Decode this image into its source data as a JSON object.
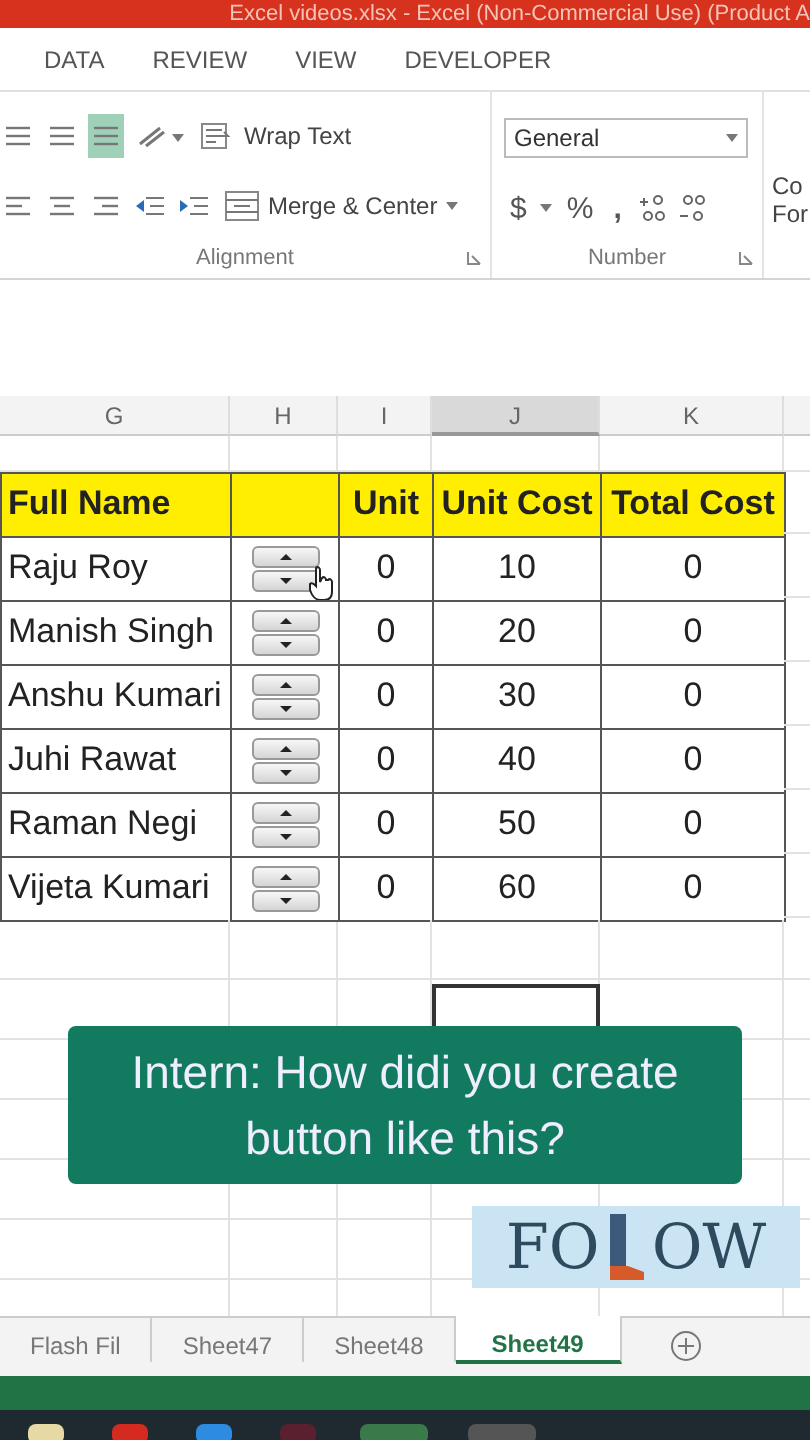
{
  "title_bar": {
    "title": "Excel videos.xlsx -  Excel (Non-Commercial Use) (Product A"
  },
  "ribbon_tabs": [
    {
      "label": "DATA",
      "selected": false
    },
    {
      "label": "REVIEW",
      "selected": false
    },
    {
      "label": "VIEW",
      "selected": false
    },
    {
      "label": "DEVELOPER",
      "selected": false
    }
  ],
  "alignment": {
    "vertical_align": [
      {
        "selected": false
      },
      {
        "selected": false
      },
      {
        "selected": true
      }
    ],
    "wrap_text": "Wrap Text",
    "merge_center": "Merge & Center",
    "label": "Alignment"
  },
  "number": {
    "format": "General",
    "currency": "$",
    "percent": "%",
    "comma": ",",
    "label": "Number"
  },
  "styles": {
    "line_1": "Co",
    "line_2": "For"
  },
  "columns": [
    {
      "label": "G",
      "selected": false
    },
    {
      "label": "H",
      "selected": false
    },
    {
      "label": "I",
      "selected": false
    },
    {
      "label": "J",
      "selected": true
    },
    {
      "label": "K",
      "selected": false
    }
  ],
  "table": {
    "headers": [
      "Full Name",
      "Unit",
      "Unit Cost",
      "Total Cost"
    ],
    "rows": [
      {
        "name": "Raju Roy",
        "unit": "0",
        "unit_cost": "10",
        "total_cost": "0",
        "hovered": true
      },
      {
        "name": "Manish Singh",
        "unit": "0",
        "unit_cost": "20",
        "total_cost": "0",
        "hovered": false
      },
      {
        "name": "Anshu Kumari",
        "unit": "0",
        "unit_cost": "30",
        "total_cost": "0",
        "hovered": false
      },
      {
        "name": "Juhi Rawat",
        "unit": "0",
        "unit_cost": "40",
        "total_cost": "0",
        "hovered": false
      },
      {
        "name": "Raman Negi",
        "unit": "0",
        "unit_cost": "50",
        "total_cost": "0",
        "hovered": false
      },
      {
        "name": "Vijeta Kumari",
        "unit": "0",
        "unit_cost": "60",
        "total_cost": "0",
        "hovered": false
      }
    ]
  },
  "caption": "Intern: How didi you create button like this?",
  "follow_sticker": {
    "left": "FO",
    "right": "OW"
  },
  "sheet_tabs": [
    {
      "label": "Flash Fil",
      "selected": false
    },
    {
      "label": "Sheet47",
      "selected": false
    },
    {
      "label": "Sheet48",
      "selected": false
    },
    {
      "label": "Sheet49",
      "selected": true
    }
  ]
}
